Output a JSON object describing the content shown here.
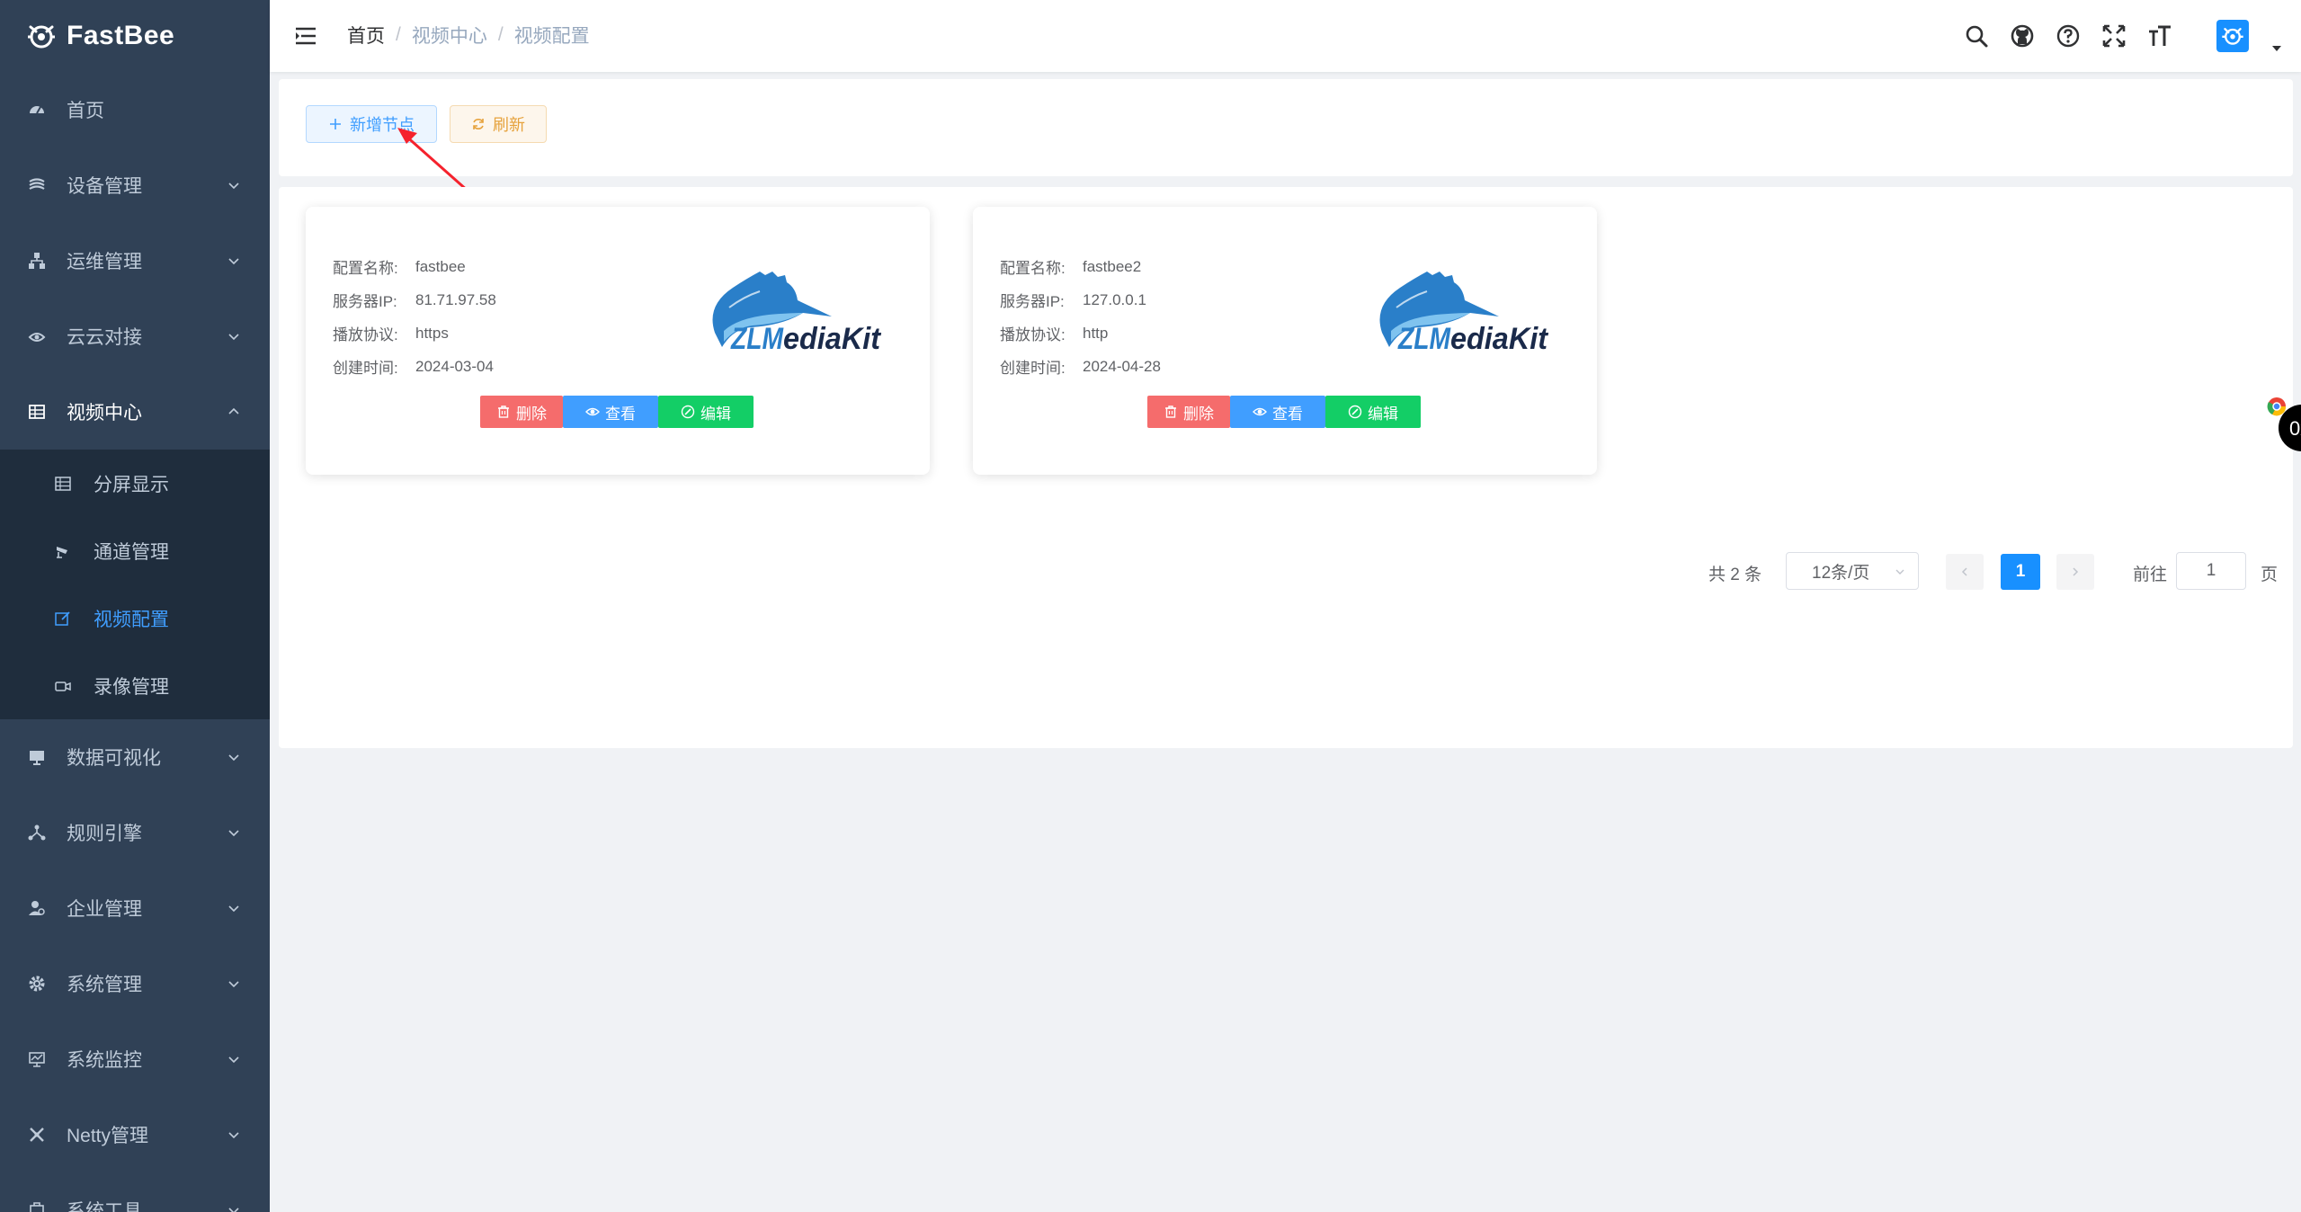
{
  "app": {
    "name": "FastBee"
  },
  "colors": {
    "sidebar_bg": "#304156",
    "submenu_bg": "#1f2d3d",
    "accent": "#409eff",
    "danger": "#f56c6c",
    "success": "#13ce66",
    "warning": "#e6a23c"
  },
  "sidebar": {
    "items": [
      {
        "label": "首页",
        "icon": "dashboard-icon"
      },
      {
        "label": "设备管理",
        "icon": "layers-icon"
      },
      {
        "label": "运维管理",
        "icon": "tree-icon"
      },
      {
        "label": "云云对接",
        "icon": "cloud-icon"
      },
      {
        "label": "视频中心",
        "icon": "table-icon",
        "expanded": true,
        "children": [
          {
            "label": "分屏显示",
            "icon": "grid-icon"
          },
          {
            "label": "通道管理",
            "icon": "camera-icon"
          },
          {
            "label": "视频配置",
            "icon": "edit-icon",
            "active": true
          },
          {
            "label": "录像管理",
            "icon": "video-icon"
          }
        ]
      },
      {
        "label": "数据可视化",
        "icon": "monitor-icon"
      },
      {
        "label": "规则引擎",
        "icon": "nodes-icon"
      },
      {
        "label": "企业管理",
        "icon": "user-icon"
      },
      {
        "label": "系统管理",
        "icon": "gear-icon"
      },
      {
        "label": "系统监控",
        "icon": "chart-icon"
      },
      {
        "label": "Netty管理",
        "icon": "cross-icon"
      },
      {
        "label": "系统工具",
        "icon": "tool-icon"
      }
    ]
  },
  "breadcrumb": {
    "home": "首页",
    "sep": "/",
    "section": "视频中心",
    "current": "视频配置"
  },
  "header_icons": [
    "search-icon",
    "github-icon",
    "help-icon",
    "fullscreen-icon",
    "font-size-icon"
  ],
  "toolbar": {
    "add_label": "新增节点",
    "refresh_label": "刷新"
  },
  "cards": [
    {
      "name_label": "配置名称:",
      "name": "fastbee",
      "ip_label": "服务器IP:",
      "ip": "81.71.97.58",
      "protocol_label": "播放协议:",
      "protocol": "https",
      "created_label": "创建时间:",
      "created": "2024-03-04",
      "logo_text": "ZLMediaKit"
    },
    {
      "name_label": "配置名称:",
      "name": "fastbee2",
      "ip_label": "服务器IP:",
      "ip": "127.0.0.1",
      "protocol_label": "播放协议:",
      "protocol": "http",
      "created_label": "创建时间:",
      "created": "2024-04-28",
      "logo_text": "ZLMediaKit"
    }
  ],
  "card_buttons": {
    "delete": "删除",
    "view": "查看",
    "edit": "编辑"
  },
  "pagination": {
    "total": "共 2 条",
    "page_size": "12条/页",
    "current_page": "1",
    "goto_label": "前往",
    "goto_value": "1",
    "page_suffix": "页"
  }
}
